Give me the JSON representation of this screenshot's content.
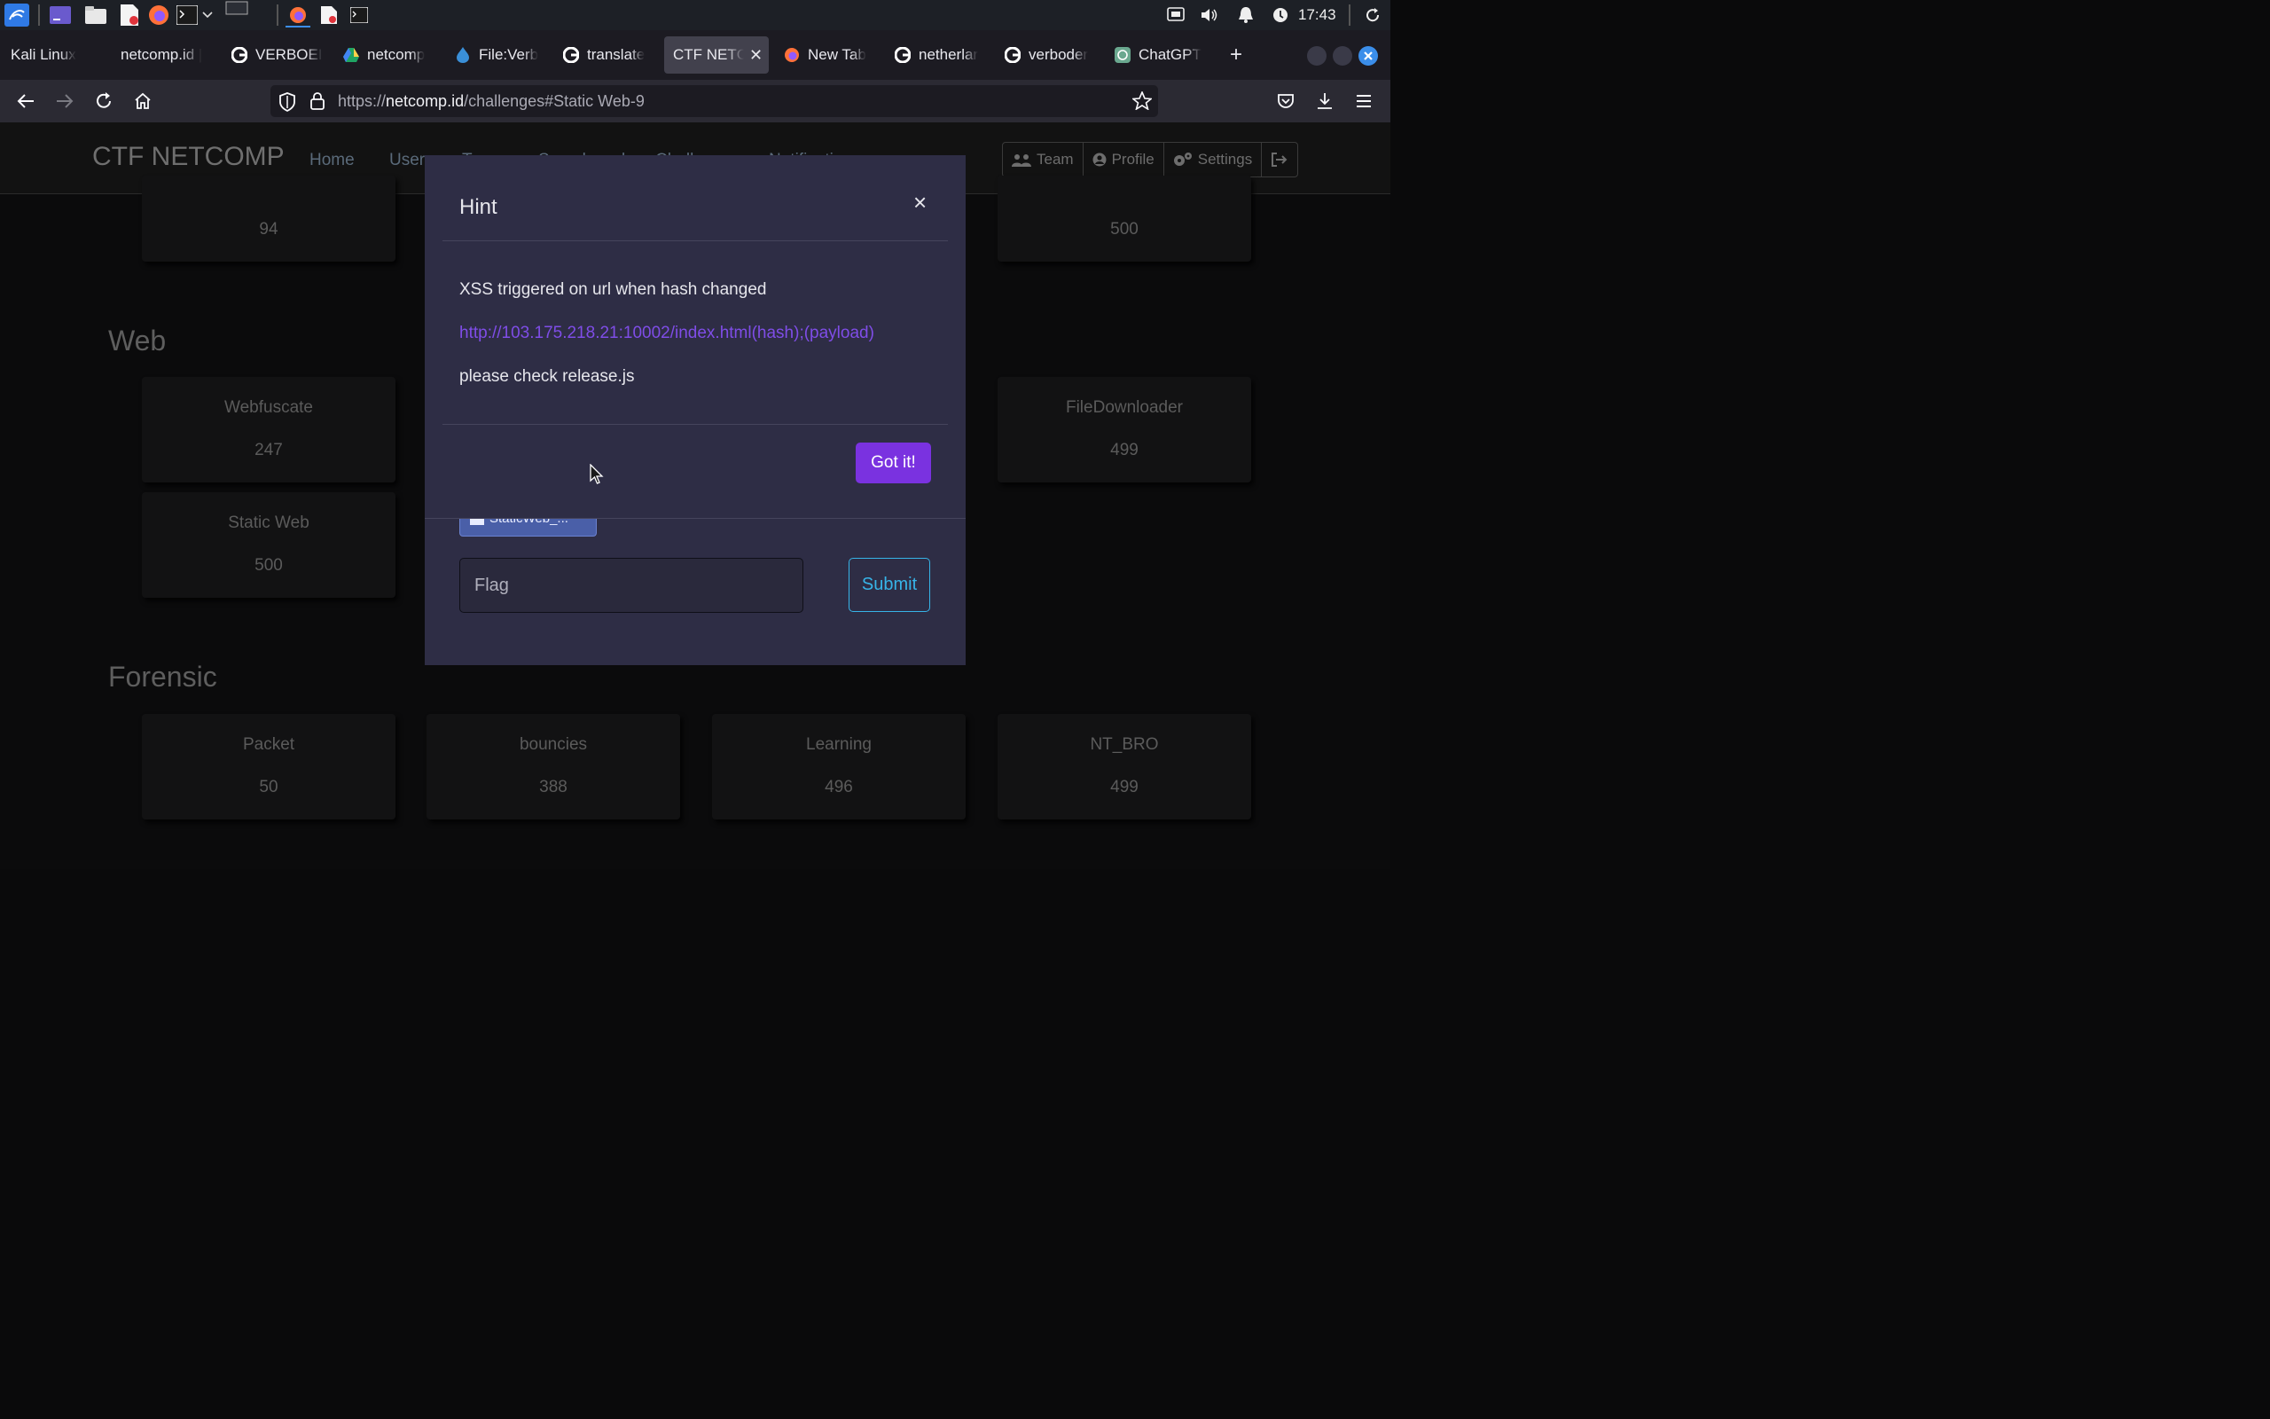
{
  "os_panel": {
    "clock": "17:43",
    "launcher_icons": [
      "kali-menu-icon",
      "workspace-icon",
      "file-manager-icon",
      "text-editor-icon",
      "firefox-icon",
      "terminal-icon",
      "chevron-down-icon",
      "workspace-switcher-icon",
      "firefox-window-icon",
      "text-editor-window-icon",
      "terminal-window-icon"
    ],
    "tray_icons": [
      "network-icon",
      "volume-icon",
      "notifications-icon",
      "power-icon",
      "refresh-icon"
    ]
  },
  "browser": {
    "tabs": [
      {
        "label": "Kali Linux",
        "favicon": "kali-favicon",
        "active": false
      },
      {
        "label": "netcomp.id |",
        "favicon": "none",
        "active": false
      },
      {
        "label": "VERBOEI",
        "favicon": "google-favicon",
        "active": false
      },
      {
        "label": "netcomp",
        "favicon": "drive-favicon",
        "active": false
      },
      {
        "label": "File:Verb",
        "favicon": "wiki-favicon",
        "active": false
      },
      {
        "label": "translate",
        "favicon": "google-favicon",
        "active": false
      },
      {
        "label": "CTF NETC",
        "favicon": "none",
        "active": true
      },
      {
        "label": "New Tab",
        "favicon": "firefox-favicon",
        "active": false
      },
      {
        "label": "netherlar",
        "favicon": "google-favicon",
        "active": false
      },
      {
        "label": "verboder",
        "favicon": "google-favicon",
        "active": false
      },
      {
        "label": "ChatGPT",
        "favicon": "chatgpt-favicon",
        "active": false
      }
    ],
    "new_tab_label": "+",
    "url_prefix": "https://",
    "url_host": "netcomp.id",
    "url_path": "/challenges#Static Web-9"
  },
  "site": {
    "brand": "CTF NETCOMP",
    "nav_links": [
      "Home",
      "Users",
      "Teams",
      "Scoreboard",
      "Challenges",
      "Notifications"
    ],
    "user_buttons": [
      {
        "label": "Team",
        "icon": "team-icon"
      },
      {
        "label": "Profile",
        "icon": "user-circle-icon"
      },
      {
        "label": "Settings",
        "icon": "gears-icon"
      },
      {
        "label": "",
        "icon": "logout-icon"
      }
    ]
  },
  "sections": {
    "top_cards": [
      {
        "name": "",
        "points": "94"
      },
      {
        "name": "",
        "points": "500"
      }
    ],
    "web": {
      "title": "Web",
      "cards": [
        {
          "name": "Webfuscate",
          "points": "247"
        },
        {
          "name": "FileDownloader",
          "points": "499"
        },
        {
          "name": "Static Web",
          "points": "500"
        }
      ]
    },
    "forensic": {
      "title": "Forensic",
      "cards": [
        {
          "name": "Packet",
          "points": "50"
        },
        {
          "name": "bouncies",
          "points": "388"
        },
        {
          "name": "Learning",
          "points": "496"
        },
        {
          "name": "NT_BRO",
          "points": "499"
        }
      ]
    }
  },
  "hint_modal": {
    "title": "Hint",
    "close": "×",
    "line1": "XSS triggered on url when hash changed",
    "link": "http://103.175.218.21:10002/index.html(hash);(payload)",
    "line3": "please check release.js",
    "button": "Got it!"
  },
  "challenge_modal": {
    "file_chip": "StaticWeb_...",
    "flag_placeholder": "Flag",
    "submit_label": "Submit"
  }
}
